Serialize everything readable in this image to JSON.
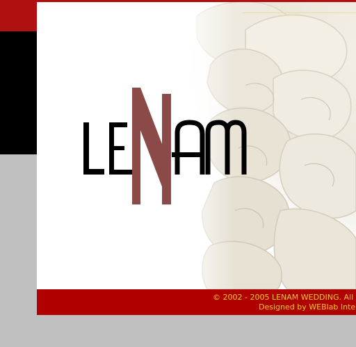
{
  "brand": {
    "logo_text": "LENAM",
    "logo_text_color": "#000000",
    "logo_accent_color": "#8b4a48"
  },
  "footer": {
    "copyright": "© 2002 - 2005 LENAM WEDDING. All",
    "designer": "Designed by WEBlab Inte"
  },
  "colors": {
    "brand_red": "#b01010",
    "footer_red": "#b00000",
    "footer_text": "#f0d020",
    "background_grey": "#c0c0c0"
  },
  "decor": {
    "background_image": "white-rose-image"
  }
}
